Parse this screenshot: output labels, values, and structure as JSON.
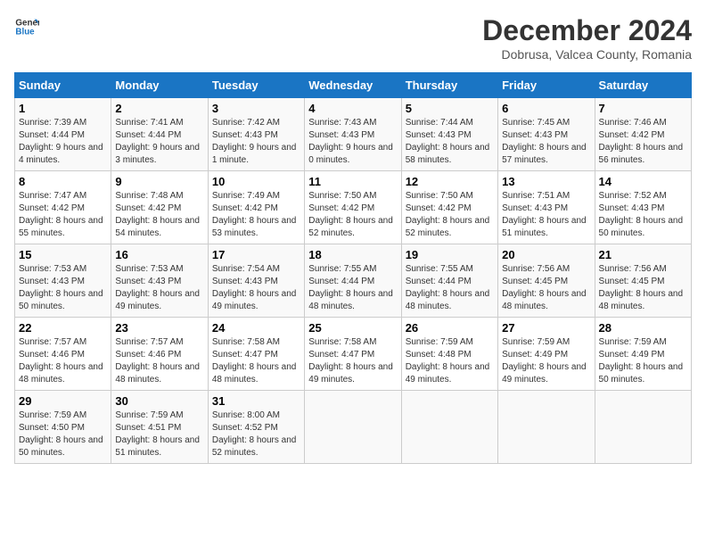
{
  "header": {
    "logo_line1": "General",
    "logo_line2": "Blue",
    "month_title": "December 2024",
    "location": "Dobrusa, Valcea County, Romania"
  },
  "weekdays": [
    "Sunday",
    "Monday",
    "Tuesday",
    "Wednesday",
    "Thursday",
    "Friday",
    "Saturday"
  ],
  "weeks": [
    [
      {
        "day": "1",
        "sunrise": "Sunrise: 7:39 AM",
        "sunset": "Sunset: 4:44 PM",
        "daylight": "Daylight: 9 hours and 4 minutes."
      },
      {
        "day": "2",
        "sunrise": "Sunrise: 7:41 AM",
        "sunset": "Sunset: 4:44 PM",
        "daylight": "Daylight: 9 hours and 3 minutes."
      },
      {
        "day": "3",
        "sunrise": "Sunrise: 7:42 AM",
        "sunset": "Sunset: 4:43 PM",
        "daylight": "Daylight: 9 hours and 1 minute."
      },
      {
        "day": "4",
        "sunrise": "Sunrise: 7:43 AM",
        "sunset": "Sunset: 4:43 PM",
        "daylight": "Daylight: 9 hours and 0 minutes."
      },
      {
        "day": "5",
        "sunrise": "Sunrise: 7:44 AM",
        "sunset": "Sunset: 4:43 PM",
        "daylight": "Daylight: 8 hours and 58 minutes."
      },
      {
        "day": "6",
        "sunrise": "Sunrise: 7:45 AM",
        "sunset": "Sunset: 4:43 PM",
        "daylight": "Daylight: 8 hours and 57 minutes."
      },
      {
        "day": "7",
        "sunrise": "Sunrise: 7:46 AM",
        "sunset": "Sunset: 4:42 PM",
        "daylight": "Daylight: 8 hours and 56 minutes."
      }
    ],
    [
      {
        "day": "8",
        "sunrise": "Sunrise: 7:47 AM",
        "sunset": "Sunset: 4:42 PM",
        "daylight": "Daylight: 8 hours and 55 minutes."
      },
      {
        "day": "9",
        "sunrise": "Sunrise: 7:48 AM",
        "sunset": "Sunset: 4:42 PM",
        "daylight": "Daylight: 8 hours and 54 minutes."
      },
      {
        "day": "10",
        "sunrise": "Sunrise: 7:49 AM",
        "sunset": "Sunset: 4:42 PM",
        "daylight": "Daylight: 8 hours and 53 minutes."
      },
      {
        "day": "11",
        "sunrise": "Sunrise: 7:50 AM",
        "sunset": "Sunset: 4:42 PM",
        "daylight": "Daylight: 8 hours and 52 minutes."
      },
      {
        "day": "12",
        "sunrise": "Sunrise: 7:50 AM",
        "sunset": "Sunset: 4:42 PM",
        "daylight": "Daylight: 8 hours and 52 minutes."
      },
      {
        "day": "13",
        "sunrise": "Sunrise: 7:51 AM",
        "sunset": "Sunset: 4:43 PM",
        "daylight": "Daylight: 8 hours and 51 minutes."
      },
      {
        "day": "14",
        "sunrise": "Sunrise: 7:52 AM",
        "sunset": "Sunset: 4:43 PM",
        "daylight": "Daylight: 8 hours and 50 minutes."
      }
    ],
    [
      {
        "day": "15",
        "sunrise": "Sunrise: 7:53 AM",
        "sunset": "Sunset: 4:43 PM",
        "daylight": "Daylight: 8 hours and 50 minutes."
      },
      {
        "day": "16",
        "sunrise": "Sunrise: 7:53 AM",
        "sunset": "Sunset: 4:43 PM",
        "daylight": "Daylight: 8 hours and 49 minutes."
      },
      {
        "day": "17",
        "sunrise": "Sunrise: 7:54 AM",
        "sunset": "Sunset: 4:43 PM",
        "daylight": "Daylight: 8 hours and 49 minutes."
      },
      {
        "day": "18",
        "sunrise": "Sunrise: 7:55 AM",
        "sunset": "Sunset: 4:44 PM",
        "daylight": "Daylight: 8 hours and 48 minutes."
      },
      {
        "day": "19",
        "sunrise": "Sunrise: 7:55 AM",
        "sunset": "Sunset: 4:44 PM",
        "daylight": "Daylight: 8 hours and 48 minutes."
      },
      {
        "day": "20",
        "sunrise": "Sunrise: 7:56 AM",
        "sunset": "Sunset: 4:45 PM",
        "daylight": "Daylight: 8 hours and 48 minutes."
      },
      {
        "day": "21",
        "sunrise": "Sunrise: 7:56 AM",
        "sunset": "Sunset: 4:45 PM",
        "daylight": "Daylight: 8 hours and 48 minutes."
      }
    ],
    [
      {
        "day": "22",
        "sunrise": "Sunrise: 7:57 AM",
        "sunset": "Sunset: 4:46 PM",
        "daylight": "Daylight: 8 hours and 48 minutes."
      },
      {
        "day": "23",
        "sunrise": "Sunrise: 7:57 AM",
        "sunset": "Sunset: 4:46 PM",
        "daylight": "Daylight: 8 hours and 48 minutes."
      },
      {
        "day": "24",
        "sunrise": "Sunrise: 7:58 AM",
        "sunset": "Sunset: 4:47 PM",
        "daylight": "Daylight: 8 hours and 48 minutes."
      },
      {
        "day": "25",
        "sunrise": "Sunrise: 7:58 AM",
        "sunset": "Sunset: 4:47 PM",
        "daylight": "Daylight: 8 hours and 49 minutes."
      },
      {
        "day": "26",
        "sunrise": "Sunrise: 7:59 AM",
        "sunset": "Sunset: 4:48 PM",
        "daylight": "Daylight: 8 hours and 49 minutes."
      },
      {
        "day": "27",
        "sunrise": "Sunrise: 7:59 AM",
        "sunset": "Sunset: 4:49 PM",
        "daylight": "Daylight: 8 hours and 49 minutes."
      },
      {
        "day": "28",
        "sunrise": "Sunrise: 7:59 AM",
        "sunset": "Sunset: 4:49 PM",
        "daylight": "Daylight: 8 hours and 50 minutes."
      }
    ],
    [
      {
        "day": "29",
        "sunrise": "Sunrise: 7:59 AM",
        "sunset": "Sunset: 4:50 PM",
        "daylight": "Daylight: 8 hours and 50 minutes."
      },
      {
        "day": "30",
        "sunrise": "Sunrise: 7:59 AM",
        "sunset": "Sunset: 4:51 PM",
        "daylight": "Daylight: 8 hours and 51 minutes."
      },
      {
        "day": "31",
        "sunrise": "Sunrise: 8:00 AM",
        "sunset": "Sunset: 4:52 PM",
        "daylight": "Daylight: 8 hours and 52 minutes."
      },
      null,
      null,
      null,
      null
    ]
  ]
}
